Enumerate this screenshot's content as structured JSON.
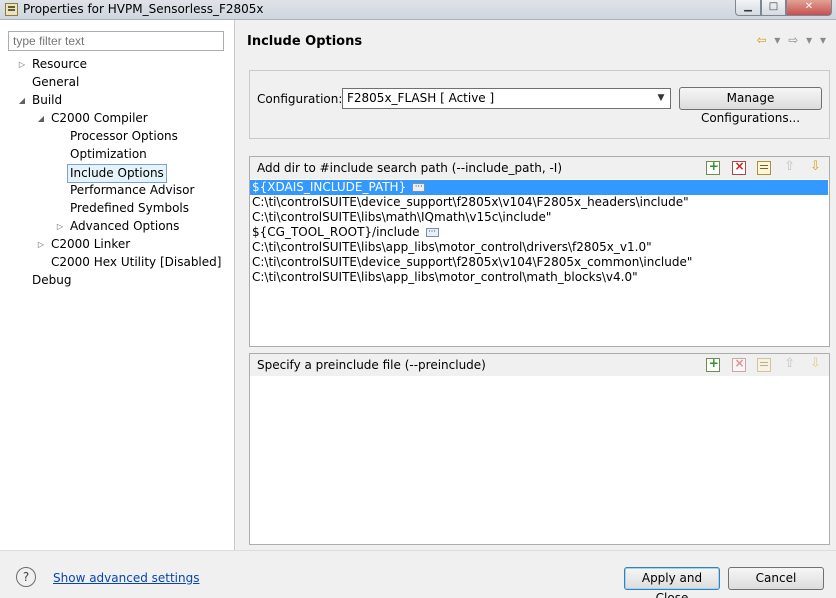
{
  "window": {
    "title": "Properties for HVPM_Sensorless_F2805x",
    "min_icon": "minimize-icon",
    "max_icon": "maximize-icon",
    "close_icon": "close-icon"
  },
  "filter": {
    "placeholder": "type filter text"
  },
  "tree": [
    {
      "label": "Resource",
      "expandable": true,
      "expanded": false,
      "level": 1
    },
    {
      "label": "General",
      "expandable": false,
      "level": 1
    },
    {
      "label": "Build",
      "expandable": true,
      "expanded": true,
      "level": 1
    },
    {
      "label": "C2000 Compiler",
      "expandable": true,
      "expanded": true,
      "level": 2
    },
    {
      "label": "Processor Options",
      "expandable": false,
      "level": 3
    },
    {
      "label": "Optimization",
      "expandable": false,
      "level": 3
    },
    {
      "label": "Include Options",
      "expandable": false,
      "level": 3,
      "selected": true
    },
    {
      "label": "Performance Advisor",
      "expandable": false,
      "level": 3
    },
    {
      "label": "Predefined Symbols",
      "expandable": false,
      "level": 3
    },
    {
      "label": "Advanced Options",
      "expandable": true,
      "expanded": false,
      "level": 3
    },
    {
      "label": "C2000 Linker",
      "expandable": true,
      "expanded": false,
      "level": 2
    },
    {
      "label": "C2000 Hex Utility  [Disabled]",
      "expandable": false,
      "level": 2
    },
    {
      "label": "Debug",
      "expandable": false,
      "level": 1
    }
  ],
  "page": {
    "title": "Include Options",
    "nav_icons": [
      "back-arrow-icon",
      "dropdown-icon",
      "forward-arrow-icon",
      "dropdown-icon",
      "view-menu-icon"
    ]
  },
  "configuration": {
    "label": "Configuration:",
    "selected": "F2805x_FLASH  [ Active ]",
    "manage_label": "Manage Configurations..."
  },
  "include_path": {
    "title": "Add dir to #include search path (--include_path, -I)",
    "items": [
      "${XDAIS_INCLUDE_PATH}",
      "C:\\ti\\controlSUITE\\device_support\\f2805x\\v104\\F2805x_headers\\include\"",
      "C:\\ti\\controlSUITE\\libs\\math\\IQmath\\v15c\\include\"",
      "${CG_TOOL_ROOT}/include",
      "C:\\ti\\controlSUITE\\libs\\app_libs\\motor_control\\drivers\\f2805x_v1.0\"",
      "C:\\ti\\controlSUITE\\device_support\\f2805x\\v104\\F2805x_common\\include\"",
      "C:\\ti\\controlSUITE\\libs\\app_libs\\motor_control\\math_blocks\\v4.0\""
    ],
    "selected_index": 0
  },
  "preinclude": {
    "title": "Specify a preinclude file (--preinclude)",
    "items": []
  },
  "footer": {
    "help_symbol": "?",
    "advanced_link": "Show advanced settings",
    "apply_label": "Apply and Close",
    "cancel_label": "Cancel"
  },
  "colors": {
    "selection": "#3399ff",
    "link": "#0645ad",
    "tree_selection_border": "#7da2ce"
  }
}
